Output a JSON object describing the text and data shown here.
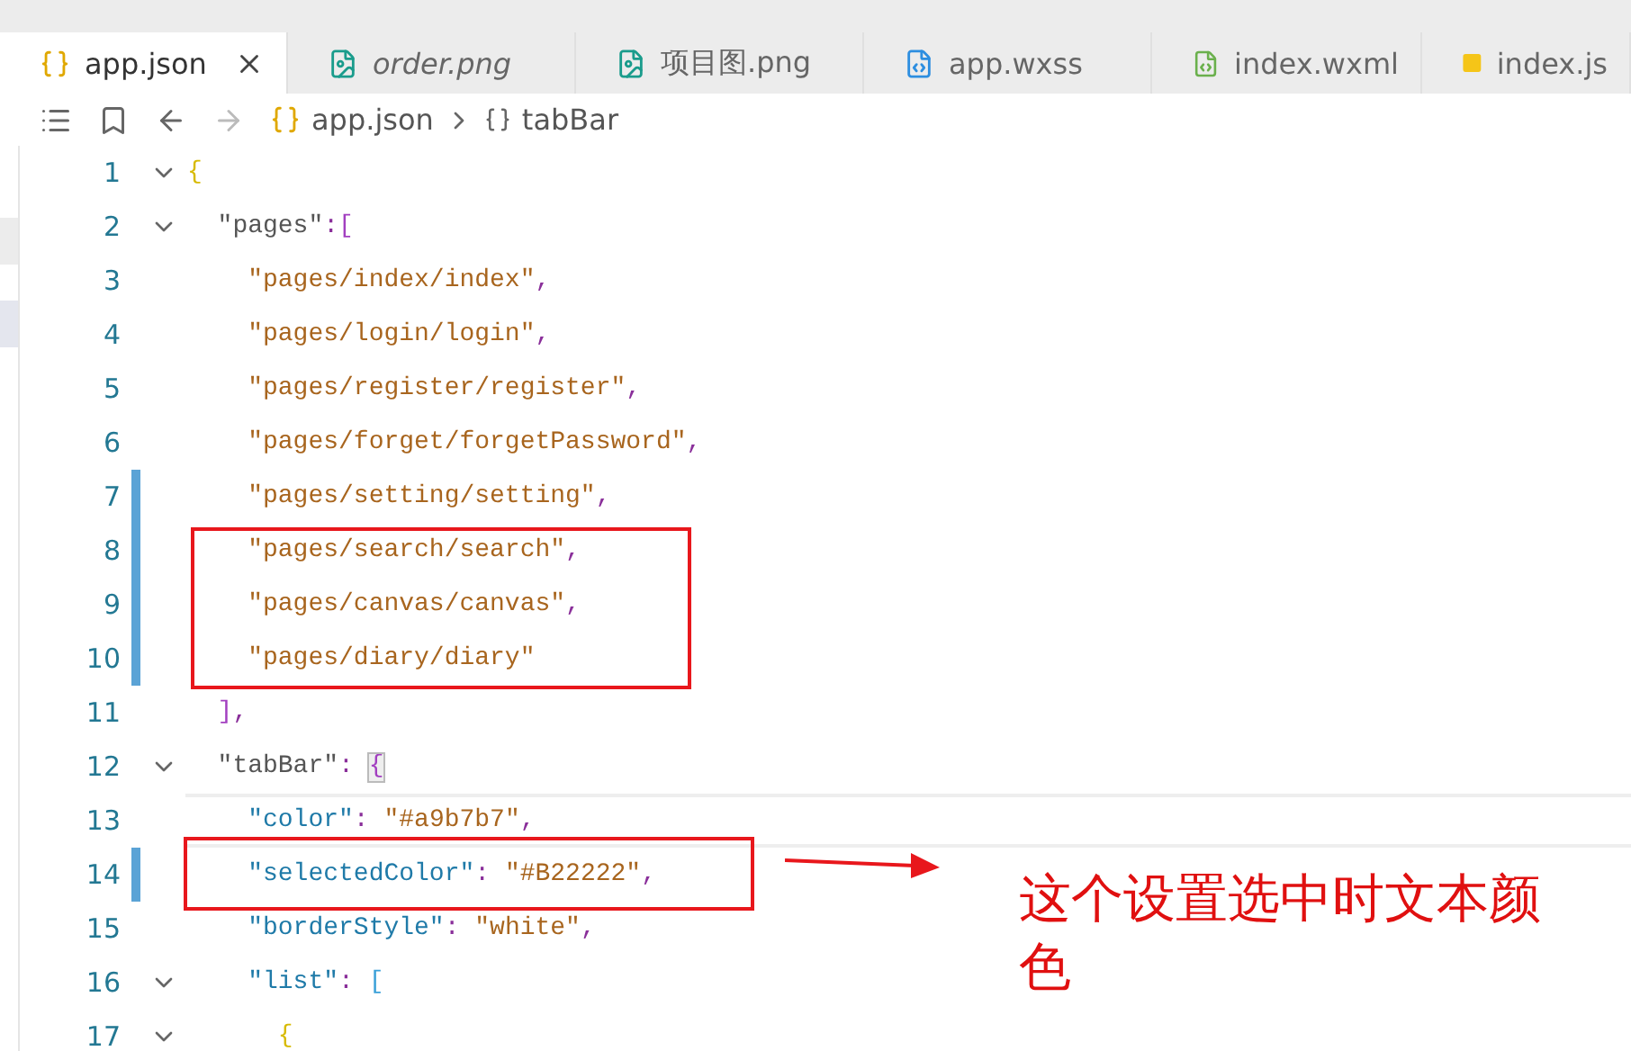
{
  "tabs": [
    {
      "label": "app.json",
      "kind": "json",
      "selected": true,
      "preview": false
    },
    {
      "label": "order.png",
      "kind": "image",
      "selected": false,
      "preview": true
    },
    {
      "label": "项目图.png",
      "kind": "image",
      "selected": false,
      "preview": false
    },
    {
      "label": "app.wxss",
      "kind": "css",
      "selected": false,
      "preview": false
    },
    {
      "label": "index.wxml",
      "kind": "wxml",
      "selected": false,
      "preview": false
    },
    {
      "label": "index.js",
      "kind": "js",
      "selected": false,
      "preview": false
    }
  ],
  "breadcrumb": {
    "file": "app.json",
    "symbol": "tabBar"
  },
  "lines": [
    {
      "number": "1",
      "fold": true,
      "modified": false,
      "current": false,
      "tokens": [
        {
          "kind": "brace",
          "text": "{"
        }
      ]
    },
    {
      "number": "2",
      "fold": true,
      "modified": false,
      "current": false,
      "tokens": [
        {
          "kind": "key",
          "text": "  \"pages\""
        },
        {
          "kind": "punct",
          "text": ":"
        },
        {
          "kind": "bracket",
          "text": "["
        }
      ]
    },
    {
      "number": "3",
      "fold": false,
      "modified": false,
      "current": false,
      "tokens": [
        {
          "kind": "string",
          "text": "    \"pages/index/index\""
        },
        {
          "kind": "punct",
          "text": ","
        }
      ]
    },
    {
      "number": "4",
      "fold": false,
      "modified": false,
      "current": false,
      "tokens": [
        {
          "kind": "string",
          "text": "    \"pages/login/login\""
        },
        {
          "kind": "punct",
          "text": ","
        }
      ]
    },
    {
      "number": "5",
      "fold": false,
      "modified": false,
      "current": false,
      "tokens": [
        {
          "kind": "string",
          "text": "    \"pages/register/register\""
        },
        {
          "kind": "punct",
          "text": ","
        }
      ]
    },
    {
      "number": "6",
      "fold": false,
      "modified": false,
      "current": false,
      "tokens": [
        {
          "kind": "string",
          "text": "    \"pages/forget/forgetPassword\""
        },
        {
          "kind": "punct",
          "text": ","
        }
      ]
    },
    {
      "number": "7",
      "fold": false,
      "modified": true,
      "current": false,
      "tokens": [
        {
          "kind": "string",
          "text": "    \"pages/setting/setting\""
        },
        {
          "kind": "punct",
          "text": ","
        }
      ]
    },
    {
      "number": "8",
      "fold": false,
      "modified": true,
      "current": false,
      "tokens": [
        {
          "kind": "string",
          "text": "    \"pages/search/search\""
        },
        {
          "kind": "punct",
          "text": ","
        }
      ]
    },
    {
      "number": "9",
      "fold": false,
      "modified": true,
      "current": false,
      "tokens": [
        {
          "kind": "string",
          "text": "    \"pages/canvas/canvas\""
        },
        {
          "kind": "punct",
          "text": ","
        }
      ]
    },
    {
      "number": "10",
      "fold": false,
      "modified": true,
      "current": false,
      "tokens": [
        {
          "kind": "string",
          "text": "    \"pages/diary/diary\""
        }
      ]
    },
    {
      "number": "11",
      "fold": false,
      "modified": false,
      "current": false,
      "tokens": [
        {
          "kind": "bracket",
          "text": "  ]"
        },
        {
          "kind": "punct",
          "text": ","
        }
      ]
    },
    {
      "number": "12",
      "fold": true,
      "modified": false,
      "current": false,
      "tokens": [
        {
          "kind": "key",
          "text": "  \"tabBar\""
        },
        {
          "kind": "punct",
          "text": ": "
        },
        {
          "kind": "matched",
          "text": "{"
        }
      ]
    },
    {
      "number": "13",
      "fold": false,
      "modified": false,
      "current": true,
      "tokens": [
        {
          "kind": "key2",
          "text": "    \"color\""
        },
        {
          "kind": "punct",
          "text": ": "
        },
        {
          "kind": "string",
          "text": "\"#a9b7b7\""
        },
        {
          "kind": "punct",
          "text": ","
        }
      ]
    },
    {
      "number": "14",
      "fold": false,
      "modified": true,
      "current": false,
      "tokens": [
        {
          "kind": "key2",
          "text": "    \"selectedColor\""
        },
        {
          "kind": "punct",
          "text": ": "
        },
        {
          "kind": "string",
          "text": "\"#B22222\""
        },
        {
          "kind": "punct",
          "text": ","
        }
      ]
    },
    {
      "number": "15",
      "fold": false,
      "modified": false,
      "current": false,
      "tokens": [
        {
          "kind": "key2",
          "text": "    \"borderStyle\""
        },
        {
          "kind": "punct",
          "text": ": "
        },
        {
          "kind": "string",
          "text": "\"white\""
        },
        {
          "kind": "punct",
          "text": ","
        }
      ]
    },
    {
      "number": "16",
      "fold": true,
      "modified": false,
      "current": false,
      "tokens": [
        {
          "kind": "key2",
          "text": "    \"list\""
        },
        {
          "kind": "punct",
          "text": ": "
        },
        {
          "kind": "bracket2",
          "text": "["
        }
      ]
    },
    {
      "number": "17",
      "fold": true,
      "modified": false,
      "current": false,
      "tokens": [
        {
          "kind": "brace",
          "text": "      {"
        }
      ]
    }
  ],
  "annotation": {
    "note": "这个设置选中时文本颜色"
  }
}
